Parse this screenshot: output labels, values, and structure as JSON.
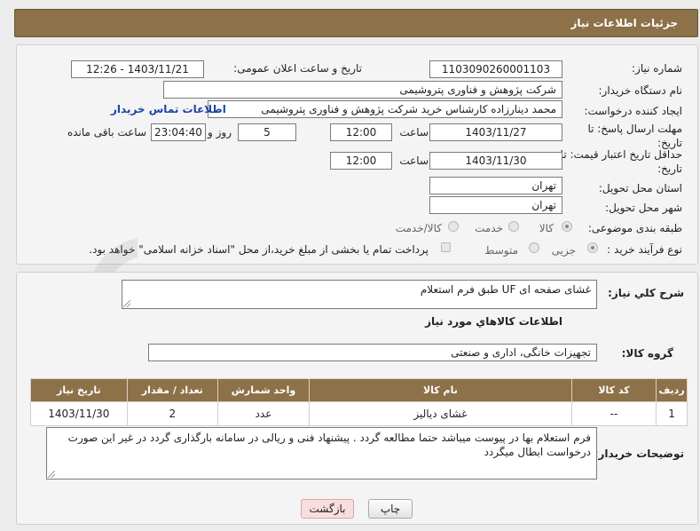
{
  "header": {
    "title": "جزئیات اطلاعات نیاز"
  },
  "form": {
    "need_number_label": "شماره نیاز:",
    "need_number": "1103090260001103",
    "announce_label": "تاریخ و ساعت اعلان عمومی:",
    "announce_value": "1403/11/21 - 12:26",
    "buyer_org_label": "نام دستگاه خریدار:",
    "buyer_org": "شرکت پژوهش و فناوری پتروشیمی",
    "creator_label": "ایجاد کننده درخواست:",
    "creator": "محمد دینارزاده کارشناس خرید شرکت پژوهش و فناوری پتروشیمی",
    "contact_link": "اطلاعات تماس خریدار",
    "deadline_label": "مهلت ارسال پاسخ: تا تاریخ:",
    "deadline_date": "1403/11/27",
    "time_label": "ساعت",
    "deadline_time": "12:00",
    "days": "5",
    "days_label": "روز و",
    "remaining_time": "23:04:40",
    "remaining_label": "ساعت باقی مانده",
    "validity_label": "حداقل تاریخ اعتبار قیمت: تا تاریخ:",
    "validity_date": "1403/11/30",
    "validity_time": "12:00",
    "province_label": "استان محل تحویل:",
    "province": "تهران",
    "city_label": "شهر محل تحویل:",
    "city": "تهران",
    "category_label": "طبقه بندی موضوعی:",
    "category_options": [
      "کالا",
      "خدمت",
      "کالا/خدمت"
    ],
    "purchase_type_label": "نوع فرآیند خرید :",
    "purchase_options": [
      "جزیی",
      "متوسط"
    ],
    "payment_note": "پرداخت تمام یا بخشی از مبلغ خرید،از محل \"اسناد خزانه اسلامی\" خواهد بود."
  },
  "description": {
    "label": "شرح کلي نياز:",
    "value": "غشای صفحه ای UF طبق فرم استعلام"
  },
  "goods_info_title": "اطلاعات كالاهاي مورد نياز",
  "goods_group": {
    "label": "گروه کالا:",
    "value": "تجهیزات خانگی، اداری و صنعتی"
  },
  "items_table": {
    "headers": [
      "ردیف",
      "کد کالا",
      "نام کالا",
      "واحد شمارش",
      "تعداد / مقدار",
      "تاریخ نیاز"
    ],
    "rows": [
      [
        "1",
        "--",
        "غشای دیالیز",
        "عدد",
        "2",
        "1403/11/30"
      ]
    ]
  },
  "buyer_notes": {
    "label": "توضیحات خریدار:",
    "value": "فرم استعلام بها در پیوست میباشد حتما مطالعه گردد . پیشنهاد فنی و ریالی در سامانه بارگذاری گردد در غیر این صورت درخواست ابطال میگردد"
  },
  "buttons": {
    "print": "چاپ",
    "back": "بازگشت"
  },
  "watermark": {
    "text": "AriaTender.neT"
  }
}
